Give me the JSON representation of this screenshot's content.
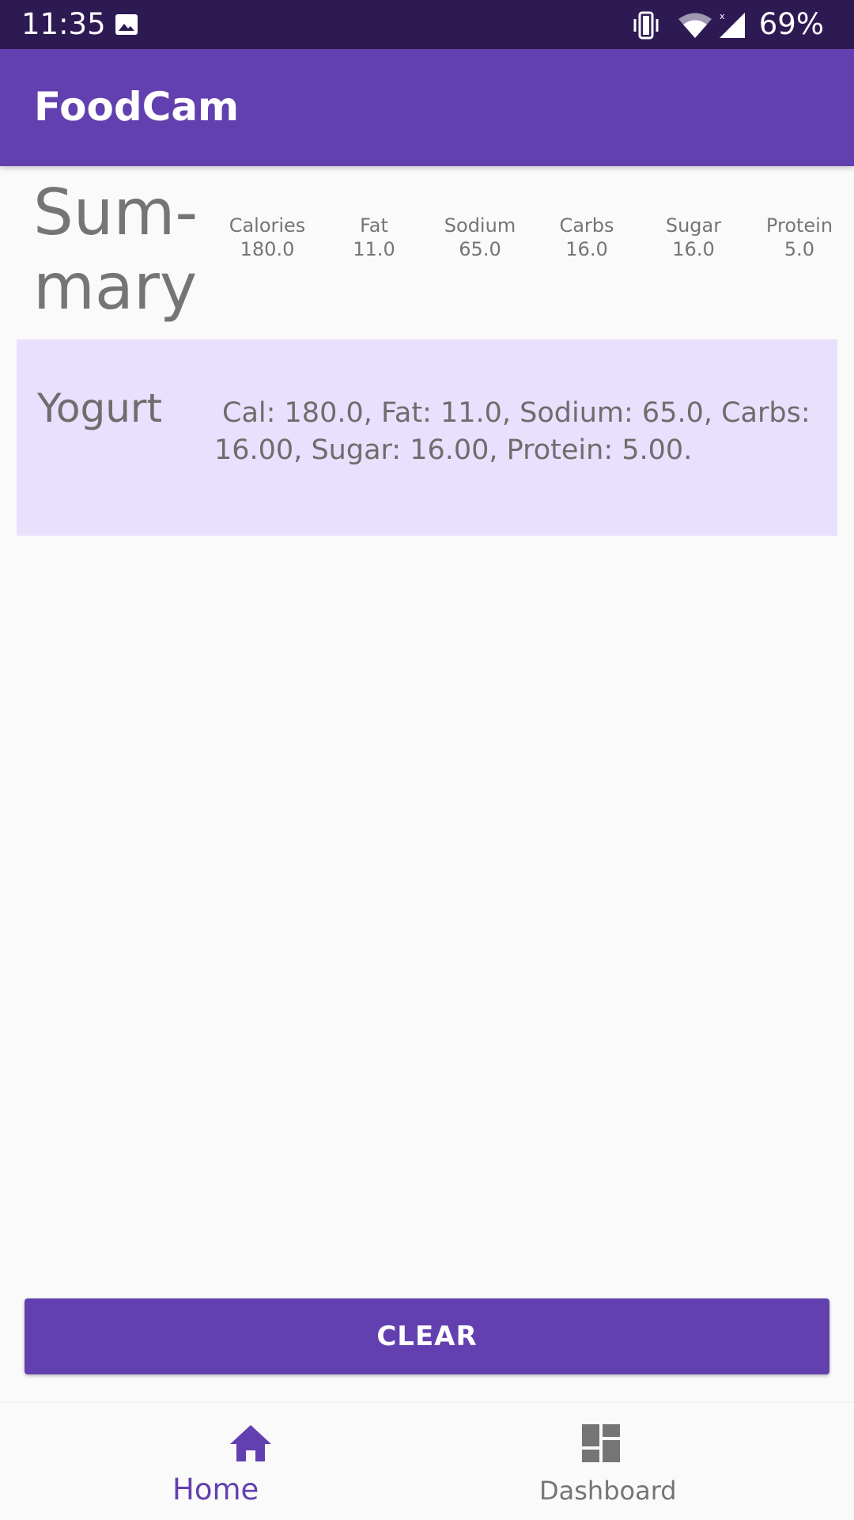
{
  "status_bar": {
    "time": "11:35",
    "battery": "69%",
    "icons": [
      "image-icon",
      "vibrate-icon",
      "wifi-icon",
      "signal-icon"
    ]
  },
  "app_bar": {
    "title": "FoodCam"
  },
  "summary": {
    "title": "Sum-mary",
    "title_line1": "Sum-",
    "title_line2": "mary",
    "stats": [
      {
        "label": "Calories",
        "value": "180.0"
      },
      {
        "label": "Fat",
        "value": "11.0"
      },
      {
        "label": "Sodium",
        "value": "65.0"
      },
      {
        "label": "Carbs",
        "value": "16.0"
      },
      {
        "label": "Sugar",
        "value": "16.0"
      },
      {
        "label": "Protein",
        "value": "5.0"
      }
    ]
  },
  "foods": [
    {
      "name": "Yogurt",
      "info": "Cal: 180.0, Fat: 11.0, Sodium: 65.0, Carbs: 16.00, Sugar: 16.00, Protein: 5.00."
    }
  ],
  "actions": {
    "clear_label": "CLEAR"
  },
  "bottom_nav": {
    "items": [
      {
        "label": "Home",
        "icon": "home-icon",
        "active": true
      },
      {
        "label": "Dashboard",
        "icon": "dashboard-icon",
        "active": false
      }
    ]
  },
  "colors": {
    "primary": "#6340af",
    "status_bar": "#2e1a53",
    "card_background": "#e9e0fd",
    "text_gray": "#757575"
  }
}
